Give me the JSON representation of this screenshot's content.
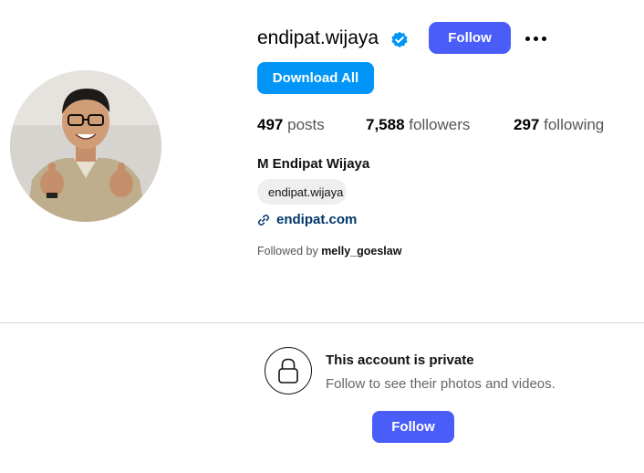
{
  "profile": {
    "username": "endipat.wijaya",
    "verified_icon": "verified-badge-icon",
    "follow_label": "Follow",
    "more_icon": "more-options-icon",
    "download_all_label": "Download All",
    "full_name": "M Endipat Wijaya",
    "threads_handle": "endipat.wijaya",
    "threads_icon": "threads-icon",
    "website": "endipat.com",
    "link_icon": "link-icon",
    "followed_by_prefix": "Followed by",
    "followed_by_user": "melly_goeslaw"
  },
  "stats": {
    "posts_count": "497",
    "posts_label": "posts",
    "followers_count": "7,588",
    "followers_label": "followers",
    "following_count": "297",
    "following_label": "following"
  },
  "private": {
    "lock_icon": "lock-icon",
    "title": "This account is private",
    "subtitle": "Follow to see their photos and videos.",
    "follow_label": "Follow"
  },
  "colors": {
    "follow_button": "#4a5df9",
    "download_button": "#0095f6",
    "verified_badge": "#0095f6",
    "link_text": "#00376b"
  }
}
